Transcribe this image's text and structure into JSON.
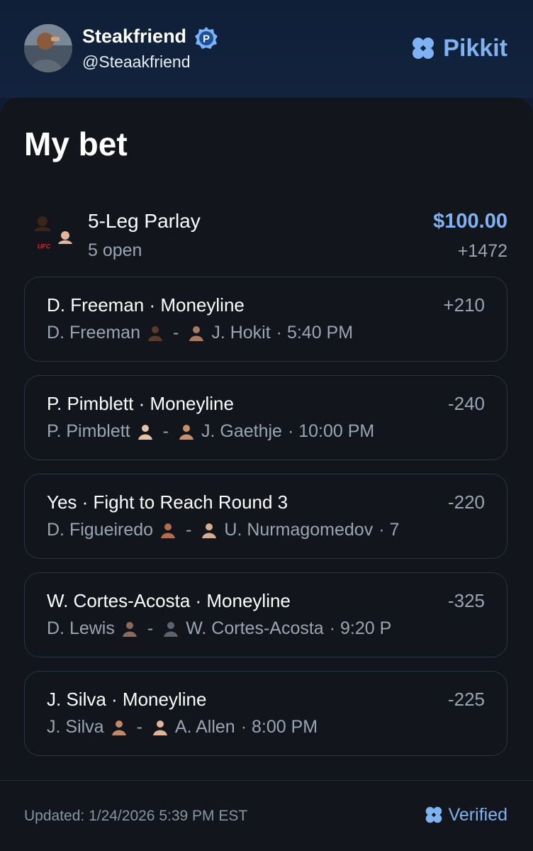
{
  "header": {
    "user_name": "Steakfriend",
    "user_handle": "@Steaakfriend",
    "brand": "Pikkit",
    "accent_color": "#7fb2f2"
  },
  "bet": {
    "title": "My bet",
    "parlay_name": "5-Leg Parlay",
    "parlay_status": "5 open",
    "stake": "$100.00",
    "odds": "+1472",
    "legs": [
      {
        "title": "D. Freeman · Moneyline",
        "odds": "+210",
        "fighter_a": "D. Freeman",
        "fighter_b": "J. Hokit",
        "time": "· 5:40 PM"
      },
      {
        "title": "P. Pimblett · Moneyline",
        "odds": "-240",
        "fighter_a": "P. Pimblett",
        "fighter_b": "J. Gaethje",
        "time": "· 10:00 PM"
      },
      {
        "title": "Yes · Fight to Reach Round 3",
        "odds": "-220",
        "fighter_a": "D. Figueiredo",
        "fighter_b": "U. Nurmagomedov",
        "time": "· 7"
      },
      {
        "title": "W. Cortes-Acosta · Moneyline",
        "odds": "-325",
        "fighter_a": "D. Lewis",
        "fighter_b": "W. Cortes-Acosta",
        "time": "· 9:20 P"
      },
      {
        "title": "J. Silva · Moneyline",
        "odds": "-225",
        "fighter_a": "J. Silva",
        "fighter_b": "A. Allen",
        "time": "· 8:00 PM"
      }
    ]
  },
  "footer": {
    "updated": "Updated: 1/24/2026 5:39 PM EST",
    "verified": "Verified"
  }
}
